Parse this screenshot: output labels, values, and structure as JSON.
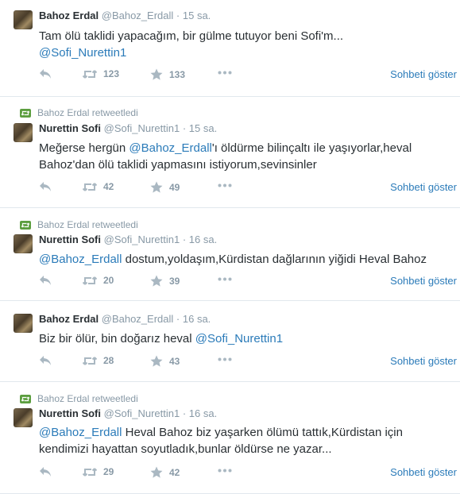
{
  "colors": {
    "link": "#2b7bb9",
    "muted": "#8899a6",
    "text": "#292f33",
    "retweet_green": "#5c9e3f"
  },
  "icons": {
    "reply": "reply-icon",
    "retweet": "retweet-icon",
    "favorite": "star-icon",
    "more": "more-icon"
  },
  "tweets": [
    {
      "name": "Bahoz Erdal",
      "handle": "@Bahoz_Erdall",
      "dot": "·",
      "time": "15 sa.",
      "parts": [
        "Tam ölü taklidi yapacağım, bir gülme tutuyor beni Sofi'm...",
        "@Sofi_Nurettin1"
      ],
      "retweets": "123",
      "favorites": "133",
      "conversation": "Sohbeti göster"
    },
    {
      "retweeted_by": "Bahoz Erdal retweetledi",
      "name": "Nurettin Sofi",
      "handle": "@Sofi_Nurettin1",
      "dot": "·",
      "time": "15 sa.",
      "parts": [
        "Meğerse hergün ",
        "@Bahoz_Erdall",
        "'ı öldürme bilinçaltı ile yaşıyorlar,heval Bahoz'dan ölü taklidi yapmasını istiyorum,sevinsinler"
      ],
      "retweets": "42",
      "favorites": "49",
      "conversation": "Sohbeti göster"
    },
    {
      "retweeted_by": "Bahoz Erdal retweetledi",
      "name": "Nurettin Sofi",
      "handle": "@Sofi_Nurettin1",
      "dot": "·",
      "time": "16 sa.",
      "parts": [
        "@Bahoz_Erdall",
        " dostum,yoldaşım,Kürdistan dağlarının yiğidi Heval Bahoz"
      ],
      "retweets": "20",
      "favorites": "39",
      "conversation": "Sohbeti göster"
    },
    {
      "name": "Bahoz Erdal",
      "handle": "@Bahoz_Erdall",
      "dot": "·",
      "time": "16 sa.",
      "parts": [
        "Biz bir ölür, bin doğarız heval ",
        "@Sofi_Nurettin1"
      ],
      "retweets": "28",
      "favorites": "43",
      "conversation": "Sohbeti göster"
    },
    {
      "retweeted_by": "Bahoz Erdal retweetledi",
      "name": "Nurettin Sofi",
      "handle": "@Sofi_Nurettin1",
      "dot": "·",
      "time": "16 sa.",
      "parts": [
        "@Bahoz_Erdall",
        " Heval Bahoz biz yaşarken ölümü tattık,Kürdistan için kendimizi hayattan soyutladık,bunlar öldürse ne yazar..."
      ],
      "retweets": "29",
      "favorites": "42",
      "conversation": "Sohbeti göster"
    }
  ]
}
